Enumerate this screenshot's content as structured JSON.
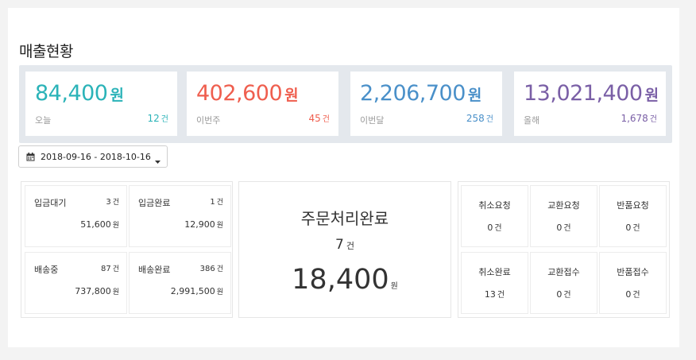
{
  "page_title": "매출현황",
  "stats": [
    {
      "value": "84,400",
      "unit": "원",
      "label": "오늘",
      "count": "12",
      "count_unit": "건",
      "color": "#2bb3b8"
    },
    {
      "value": "402,600",
      "unit": "원",
      "label": "이번주",
      "count": "45",
      "count_unit": "건",
      "color": "#ef5e4e"
    },
    {
      "value": "2,206,700",
      "unit": "원",
      "label": "이번달",
      "count": "258",
      "count_unit": "건",
      "color": "#4a90c9"
    },
    {
      "value": "13,021,400",
      "unit": "원",
      "label": "올해",
      "count": "1,678",
      "count_unit": "건",
      "color": "#7a5fa6"
    }
  ],
  "date_range": {
    "label": "2018-09-16 - 2018-10-16",
    "icon": "calendar-icon"
  },
  "deposit_shipping": [
    {
      "label": "입금대기",
      "count": "3",
      "count_unit": "건",
      "amount": "51,600",
      "amount_unit": "원"
    },
    {
      "label": "입금완료",
      "count": "1",
      "count_unit": "건",
      "amount": "12,900",
      "amount_unit": "원"
    },
    {
      "label": "배송중",
      "count": "87",
      "count_unit": "건",
      "amount": "737,800",
      "amount_unit": "원"
    },
    {
      "label": "배송완료",
      "count": "386",
      "count_unit": "건",
      "amount": "2,991,500",
      "amount_unit": "원"
    }
  ],
  "order_complete": {
    "title": "주문처리완료",
    "count": "7",
    "count_unit": "건",
    "amount": "18,400",
    "amount_unit": "원"
  },
  "claims": [
    {
      "label": "취소요청",
      "count": "0",
      "count_unit": "건"
    },
    {
      "label": "교환요청",
      "count": "0",
      "count_unit": "건"
    },
    {
      "label": "반품요청",
      "count": "0",
      "count_unit": "건"
    },
    {
      "label": "취소완료",
      "count": "13",
      "count_unit": "건"
    },
    {
      "label": "교환접수",
      "count": "0",
      "count_unit": "건"
    },
    {
      "label": "반품접수",
      "count": "0",
      "count_unit": "건"
    }
  ]
}
